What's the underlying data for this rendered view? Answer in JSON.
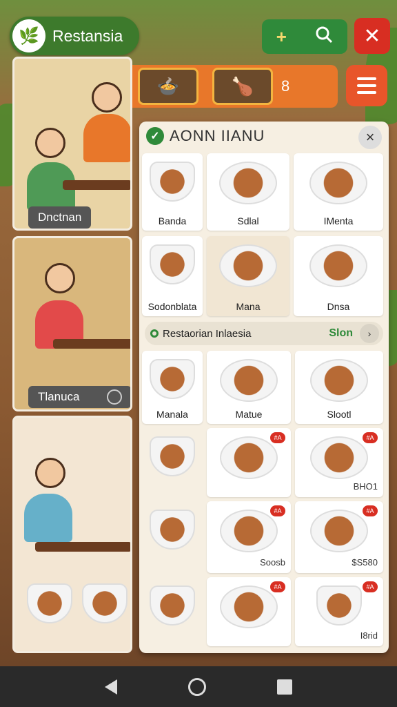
{
  "app": {
    "title": "Restansia",
    "logo_icon": "herb-logo-icon"
  },
  "toolbar": {
    "add_label": "+",
    "search_icon": "search-icon",
    "close_icon": "close-x-icon",
    "menu_icon": "hamburger-icon",
    "strip_page": "8"
  },
  "photos": [
    {
      "caption": "Dnctnan"
    },
    {
      "caption": "Tlanuca"
    },
    {
      "caption": ""
    }
  ],
  "menu": {
    "title": "AONN IIANU",
    "grid1": [
      {
        "label": "Banda",
        "icon": "rice-bowl"
      },
      {
        "label": "Sdlal",
        "icon": "grilled-meat"
      },
      {
        "label": "IMenta",
        "icon": "fried-fish"
      },
      {
        "label": "Sodonblata",
        "icon": "mixed-bowl"
      },
      {
        "label": "Mana",
        "icon": "noodle-plate"
      },
      {
        "label": "Dnsa",
        "icon": "curry-plate"
      }
    ],
    "section": {
      "title": "Restaorian Inlaesia",
      "link": "Slon"
    },
    "grid2": [
      {
        "label": "Manala",
        "price": "",
        "badge": "",
        "icon": "rice-bowl"
      },
      {
        "label": "Matue",
        "price": "",
        "badge": "",
        "icon": "grilled-meat"
      },
      {
        "label": "Slootl",
        "price": "",
        "badge": "",
        "icon": "stew-plate"
      },
      {
        "label": "",
        "price": "",
        "badge": "",
        "icon": "soup-bowl"
      },
      {
        "label": "",
        "price": "BHO1",
        "badge": "#A",
        "icon": "sate-plate"
      },
      {
        "label": "",
        "price": "",
        "badge": "#A",
        "icon": "fish-plate"
      },
      {
        "label": "",
        "price": "",
        "badge": "",
        "icon": "rice-bowl"
      },
      {
        "label": "",
        "price": "Soosb",
        "badge": "#A",
        "icon": "grilled-meat"
      },
      {
        "label": "",
        "price": "$S580",
        "badge": "#A",
        "icon": "beef-plate"
      },
      {
        "label": "",
        "price": "",
        "badge": "",
        "icon": "rice-bowl"
      },
      {
        "label": "",
        "price": "",
        "badge": "#A",
        "icon": "meatball-plate"
      },
      {
        "label": "",
        "price": "I8rid",
        "badge": "#A",
        "icon": "noodle-bowl"
      }
    ]
  },
  "nav": {
    "back": "back-icon",
    "home": "home-icon",
    "recent": "recent-apps-icon"
  }
}
